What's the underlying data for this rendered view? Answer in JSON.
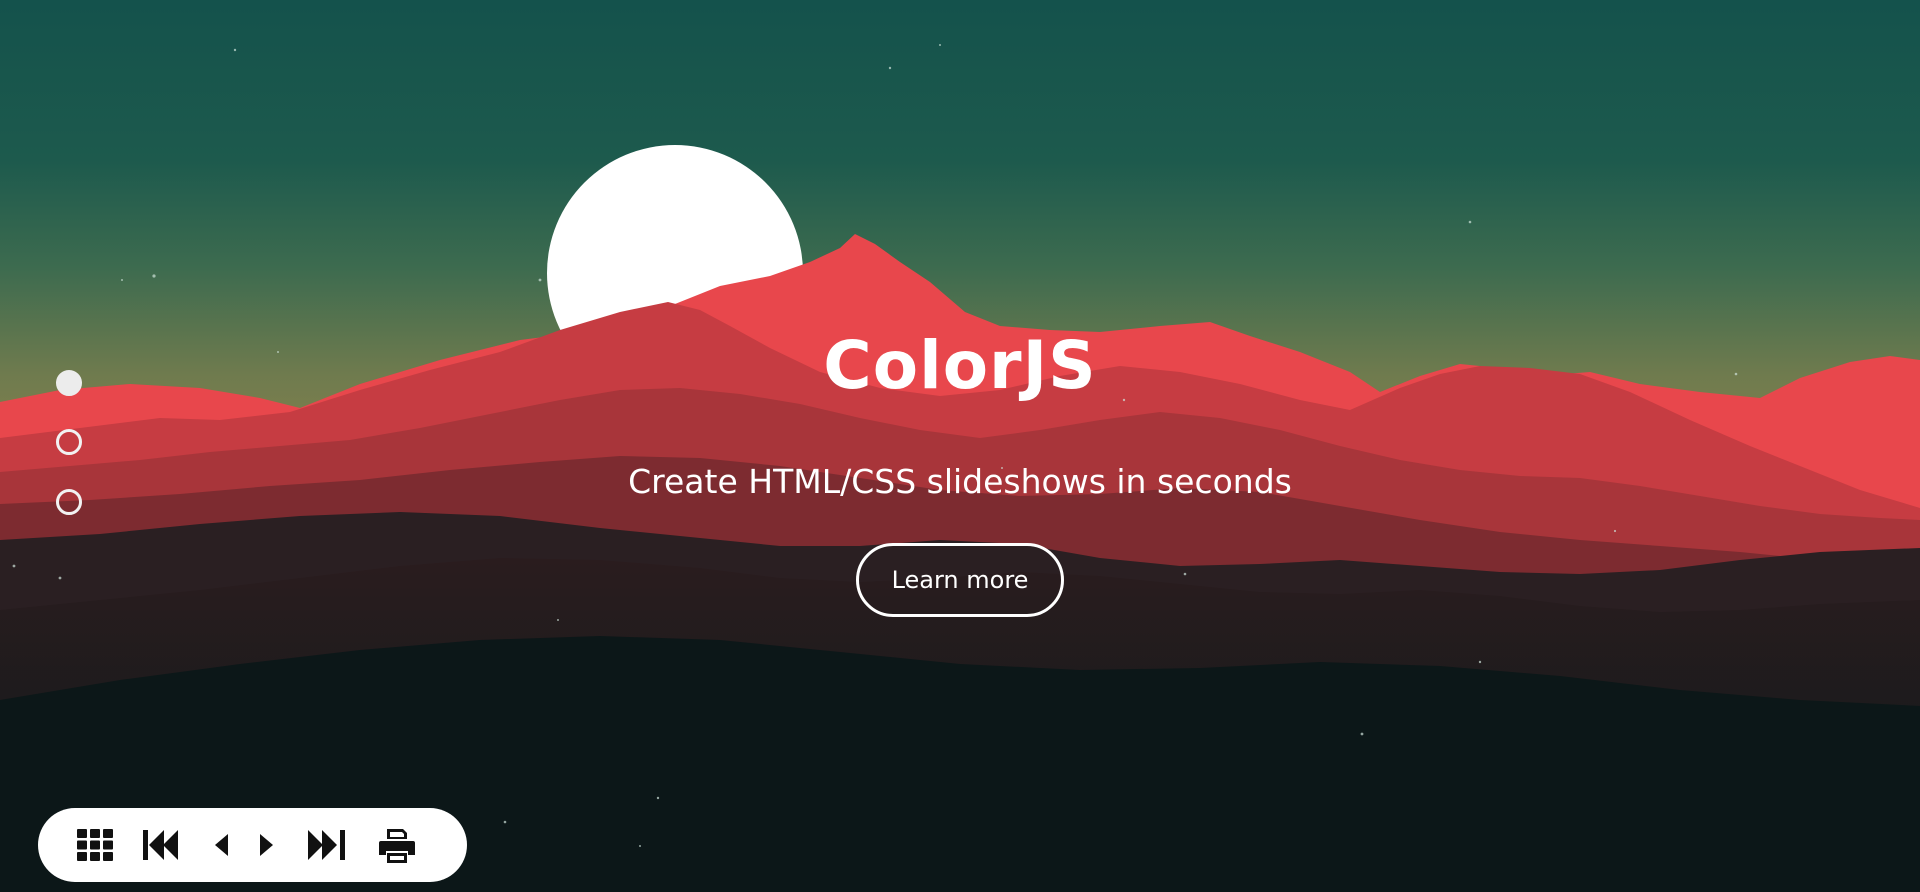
{
  "hero": {
    "title": "ColorJS",
    "subtitle": "Create HTML/CSS slideshows in seconds",
    "cta_label": "Learn more"
  },
  "slide_nav": {
    "count": 3,
    "active_index": 0
  },
  "toolbar": {
    "buttons": [
      "grid-icon",
      "first-slide-icon",
      "previous-slide-icon",
      "next-slide-icon",
      "last-slide-icon",
      "print-icon"
    ]
  },
  "colors": {
    "sky_top": "#14524c",
    "sky_horizon": "#82804c",
    "mountain_red": "#e2434b",
    "ground_dark": "#0b1718",
    "text": "#ffffff"
  }
}
